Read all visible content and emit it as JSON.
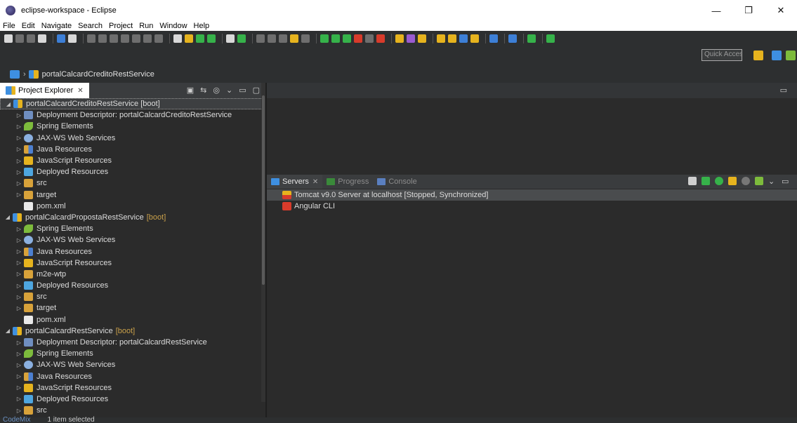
{
  "window": {
    "title": "eclipse-workspace - Eclipse",
    "controls": [
      "—",
      "❐",
      "✕"
    ]
  },
  "menu": [
    "File",
    "Edit",
    "Navigate",
    "Search",
    "Project",
    "Run",
    "Window",
    "Help"
  ],
  "toolbar": {
    "quick_access": "Quick Access"
  },
  "breadcrumb": {
    "project": "portalCalcardCreditoRestService"
  },
  "project_explorer": {
    "tab_label": "Project Explorer",
    "close_glyph": "✕",
    "items": [
      {
        "label": "portalCalcardCreditoRestService [boot]",
        "level": 0,
        "expanded": true,
        "icon": "project-icon",
        "selected": true
      },
      {
        "label": "Deployment Descriptor: portalCalcardCreditoRestService",
        "level": 1,
        "icon": "deployment-descriptor-icon"
      },
      {
        "label": "Spring Elements",
        "level": 1,
        "icon": "spring-icon"
      },
      {
        "label": "JAX-WS Web Services",
        "level": 1,
        "icon": "jaxws-icon"
      },
      {
        "label": "Java Resources",
        "level": 1,
        "icon": "java-resources-icon"
      },
      {
        "label": "JavaScript Resources",
        "level": 1,
        "icon": "javascript-resources-icon"
      },
      {
        "label": "Deployed Resources",
        "level": 1,
        "icon": "deployed-resources-icon"
      },
      {
        "label": "src",
        "level": 1,
        "icon": "folder-icon"
      },
      {
        "label": "target",
        "level": 1,
        "icon": "folder-icon"
      },
      {
        "label": "pom.xml",
        "level": 1,
        "icon": "file-icon",
        "leaf": true
      },
      {
        "label": "portalCalcardPropostaRestService",
        "boot": "[boot]",
        "level": 0,
        "expanded": true,
        "icon": "project-icon"
      },
      {
        "label": "Spring Elements",
        "level": 1,
        "icon": "spring-icon"
      },
      {
        "label": "JAX-WS Web Services",
        "level": 1,
        "icon": "jaxws-icon"
      },
      {
        "label": "Java Resources",
        "level": 1,
        "icon": "java-resources-icon"
      },
      {
        "label": "JavaScript Resources",
        "level": 1,
        "icon": "javascript-resources-icon"
      },
      {
        "label": "m2e-wtp",
        "level": 1,
        "icon": "folder-icon"
      },
      {
        "label": "Deployed Resources",
        "level": 1,
        "icon": "deployed-resources-icon"
      },
      {
        "label": "src",
        "level": 1,
        "icon": "folder-icon"
      },
      {
        "label": "target",
        "level": 1,
        "icon": "folder-icon"
      },
      {
        "label": "pom.xml",
        "level": 1,
        "icon": "file-icon",
        "leaf": true
      },
      {
        "label": "portalCalcardRestService",
        "boot": "[boot]",
        "level": 0,
        "expanded": true,
        "icon": "project-icon"
      },
      {
        "label": "Deployment Descriptor: portalCalcardRestService",
        "level": 1,
        "icon": "deployment-descriptor-icon"
      },
      {
        "label": "Spring Elements",
        "level": 1,
        "icon": "spring-icon"
      },
      {
        "label": "JAX-WS Web Services",
        "level": 1,
        "icon": "jaxws-icon"
      },
      {
        "label": "Java Resources",
        "level": 1,
        "icon": "java-resources-icon"
      },
      {
        "label": "JavaScript Resources",
        "level": 1,
        "icon": "javascript-resources-icon"
      },
      {
        "label": "Deployed Resources",
        "level": 1,
        "icon": "deployed-resources-icon"
      },
      {
        "label": "src",
        "level": 1,
        "icon": "folder-icon"
      }
    ]
  },
  "servers_view": {
    "tabs": [
      {
        "label": "Servers",
        "active": true
      },
      {
        "label": "Progress",
        "active": false
      },
      {
        "label": "Console",
        "active": false
      }
    ],
    "servers": [
      {
        "label": "Tomcat v9.0 Server at localhost  [Stopped, Synchronized]",
        "icon": "tomcat-icon",
        "selected": true
      },
      {
        "label": "Angular CLI",
        "icon": "angular-icon"
      }
    ]
  },
  "status_bar": {
    "left": "CodeMix",
    "selection": "1 item selected"
  }
}
